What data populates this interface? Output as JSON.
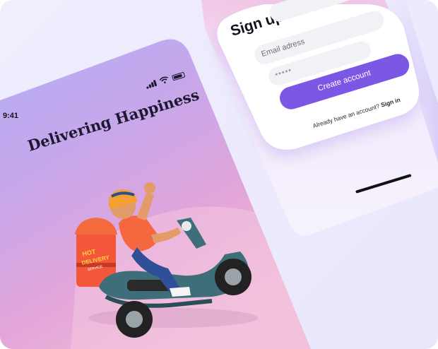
{
  "left_screen": {
    "status_time": "9:41",
    "headline": "Delivering Happiness",
    "illustration": {
      "box_text_top": "HOT",
      "box_text_main": "DELIVERY",
      "box_text_sub": "SERVICE"
    }
  },
  "signup_screen": {
    "title": "Sign up",
    "name_field_value": "",
    "email_placeholder": "Email adress",
    "password_value": "*****",
    "create_button_label": "Create account",
    "footer_text": "Already have an account?",
    "signin_link": "Sign in"
  },
  "colors": {
    "accent": "#7c57e6",
    "headline": "#1b1830",
    "background": "#efeefd"
  }
}
